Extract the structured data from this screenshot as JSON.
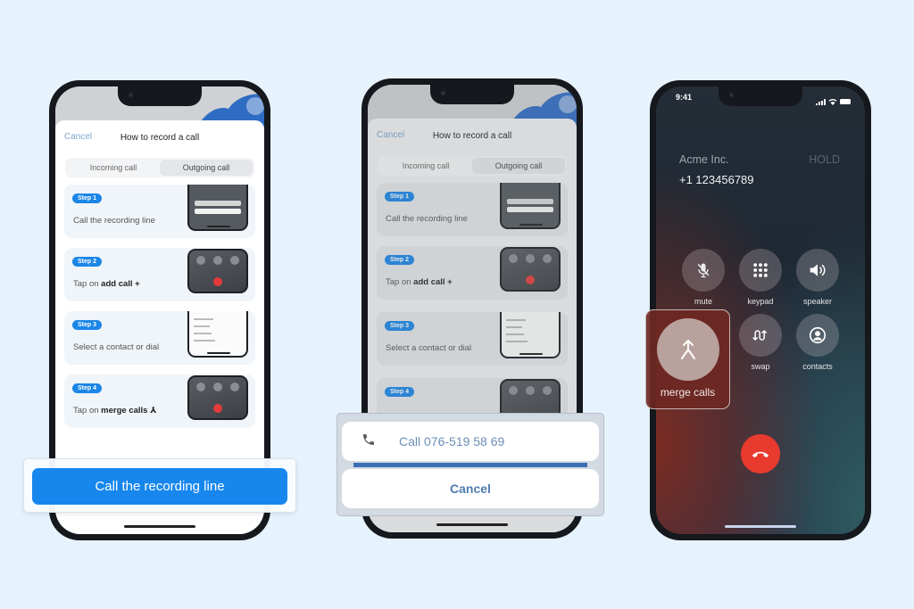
{
  "background_color": "#e6f2fc",
  "phone1": {
    "sheet": {
      "cancel_label": "Cancel",
      "title": "How to record a call",
      "tabs": [
        {
          "label": "Incoming call",
          "active": false
        },
        {
          "label": "Outgoing call",
          "active": true
        }
      ],
      "steps": [
        {
          "badge": "Step 1",
          "text": "Call the recording line",
          "bold": ""
        },
        {
          "badge": "Step 2",
          "text": "Tap on ",
          "bold": "add call +"
        },
        {
          "badge": "Step 3",
          "text": "Select a contact or dial",
          "bold": ""
        },
        {
          "badge": "Step 4",
          "text": "Tap on ",
          "bold": "merge calls ⅄"
        }
      ]
    },
    "callout": {
      "primary_button_label": "Call the recording line",
      "accent": "#1787ee"
    }
  },
  "phone2": {
    "sheet": {
      "cancel_label": "Cancel",
      "title": "How to record a call",
      "tabs": [
        {
          "label": "Incoming call",
          "active": false
        },
        {
          "label": "Outgoing call",
          "active": true
        }
      ],
      "steps": [
        {
          "badge": "Step 1",
          "text": "Call the recording line",
          "bold": ""
        },
        {
          "badge": "Step 2",
          "text": "Tap on ",
          "bold": "add call +"
        },
        {
          "badge": "Step 3",
          "text": "Select a contact or dial",
          "bold": ""
        },
        {
          "badge": "Step 4",
          "text": "",
          "bold": ""
        }
      ]
    },
    "action_sheet": {
      "call_icon": "phone-icon",
      "call_label": "Call 076-519 58 69",
      "cancel_label": "Cancel"
    }
  },
  "phone3": {
    "status": {
      "time": "9:41"
    },
    "caller": {
      "name": "Acme Inc.",
      "status": "HOLD",
      "number": "+1 123456789"
    },
    "controls": [
      {
        "icon": "mute-icon",
        "label": "mute"
      },
      {
        "icon": "keypad-icon",
        "label": "keypad"
      },
      {
        "icon": "speaker-icon",
        "label": "speaker"
      },
      {
        "icon": "swap-icon",
        "label": "swap"
      },
      {
        "icon": "contacts-icon",
        "label": "contacts"
      }
    ],
    "merge_callout": {
      "icon": "merge-icon",
      "label": "merge calls"
    },
    "end_call_color": "#e83a2f"
  }
}
